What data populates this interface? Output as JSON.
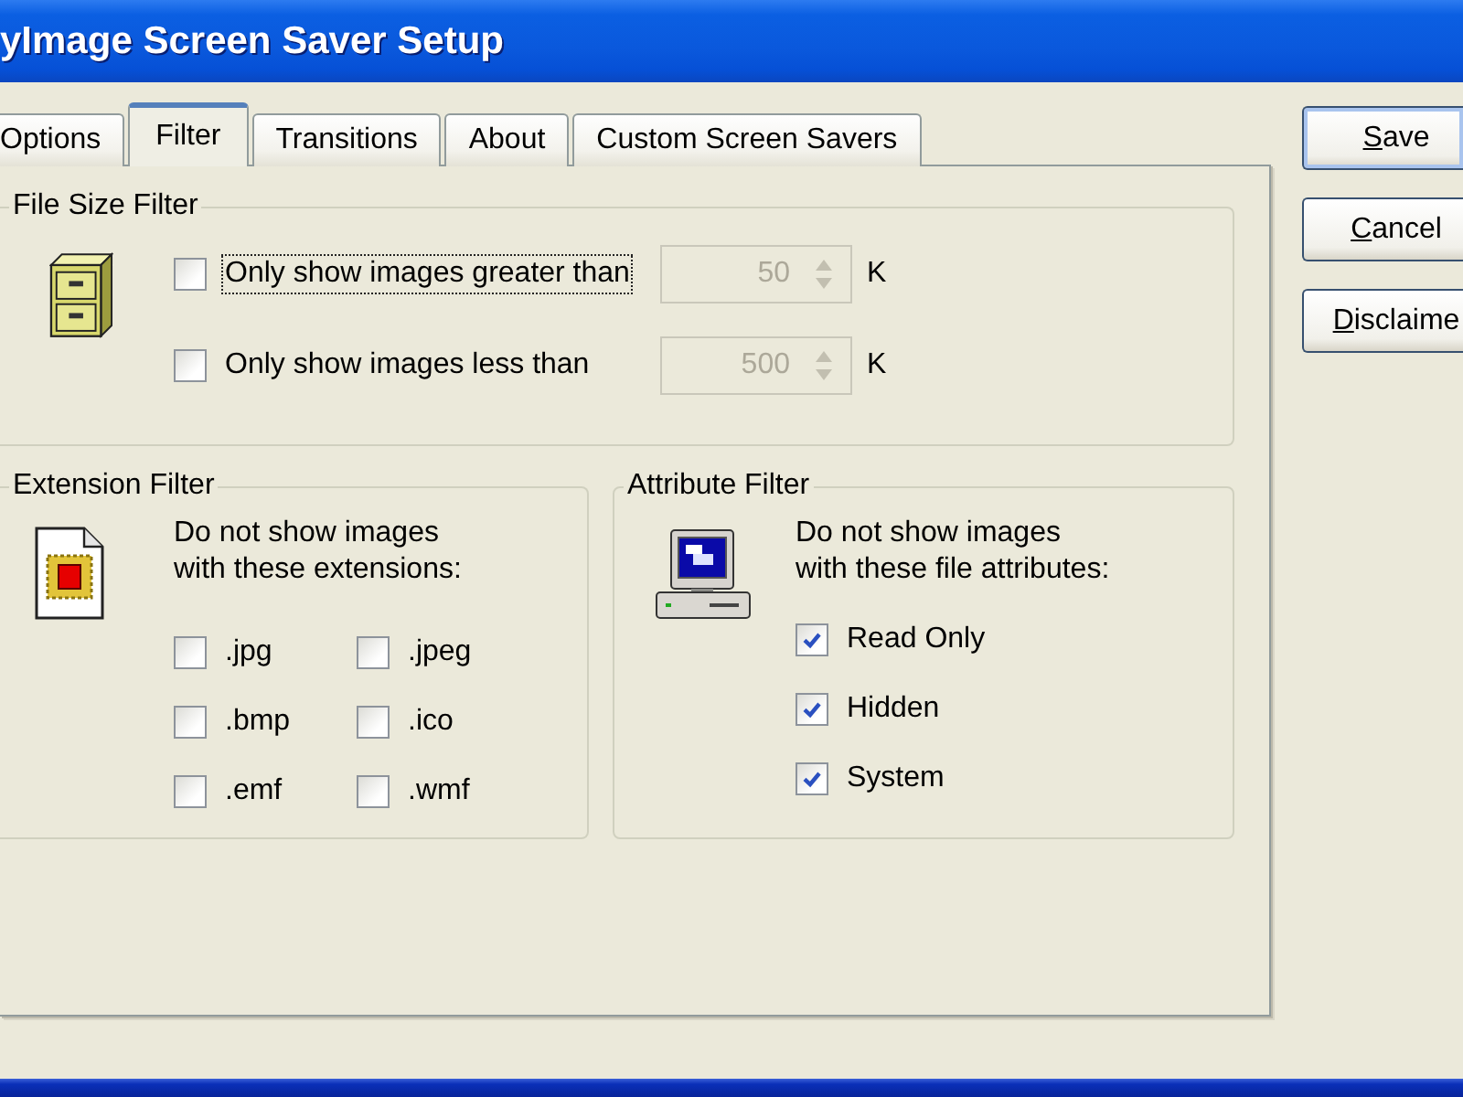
{
  "window": {
    "title": "yImage Screen Saver Setup"
  },
  "tabs": [
    {
      "label": "Options",
      "selected": false
    },
    {
      "label": "Filter",
      "selected": true
    },
    {
      "label": "Transitions",
      "selected": false
    },
    {
      "label": "About",
      "selected": false
    },
    {
      "label": "Custom Screen Savers",
      "selected": false
    }
  ],
  "file_size_filter": {
    "title": "File Size Filter",
    "rows": [
      {
        "label": "Only show images greater than",
        "checked": false,
        "focused": true,
        "value": "50",
        "disabled": true,
        "unit": "K"
      },
      {
        "label": "Only show images less than",
        "checked": false,
        "focused": false,
        "value": "500",
        "disabled": true,
        "unit": "K"
      }
    ]
  },
  "extension_filter": {
    "title": "Extension Filter",
    "description": "Do not show images\nwith these extensions:",
    "options": [
      {
        "label": ".jpg",
        "checked": false
      },
      {
        "label": ".jpeg",
        "checked": false
      },
      {
        "label": ".bmp",
        "checked": false
      },
      {
        "label": ".ico",
        "checked": false
      },
      {
        "label": ".emf",
        "checked": false
      },
      {
        "label": ".wmf",
        "checked": false
      }
    ]
  },
  "attribute_filter": {
    "title": "Attribute Filter",
    "description": "Do not show images\nwith these file attributes:",
    "options": [
      {
        "label": "Read Only",
        "checked": true
      },
      {
        "label": "Hidden",
        "checked": true
      },
      {
        "label": "System",
        "checked": true
      }
    ]
  },
  "buttons": [
    {
      "label": "Save",
      "default": true
    },
    {
      "label": "Cancel",
      "default": false
    },
    {
      "label": "Disclaime",
      "default": false
    }
  ]
}
